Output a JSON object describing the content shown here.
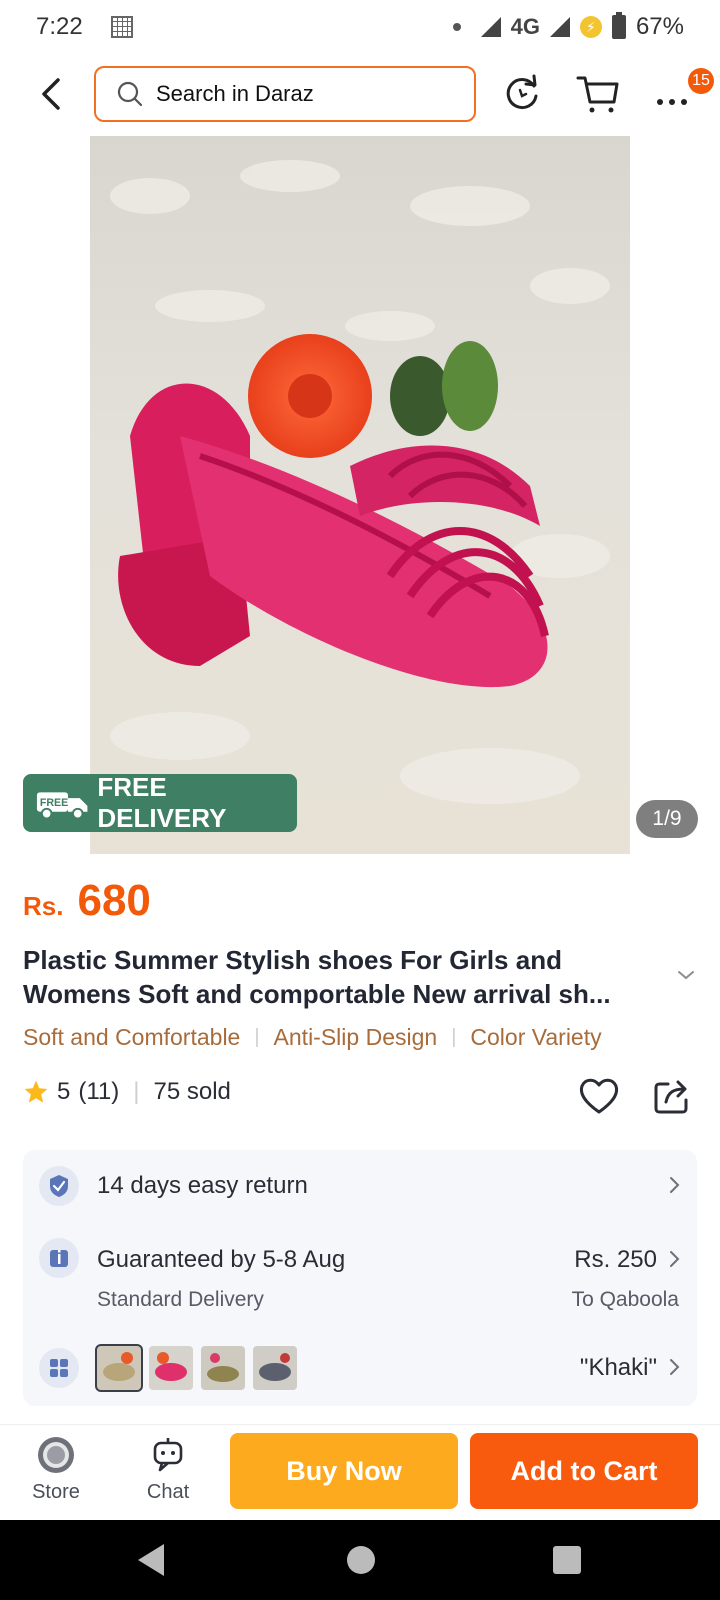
{
  "status_bar": {
    "time": "7:22",
    "network": "4G",
    "battery": "67%"
  },
  "search": {
    "placeholder": "Search in Daraz"
  },
  "header": {
    "badge_count": "15"
  },
  "gallery": {
    "free_delivery": "FREE DELIVERY",
    "free_tag": "FREE",
    "counter": "1/9"
  },
  "product": {
    "currency": "Rs.",
    "price": "680",
    "title_line1": "Plastic Summer Stylish shoes For Girls and",
    "title_line2": "Womens Soft and comportable New arrival sh...",
    "features": [
      "Soft and Comfortable",
      "Anti-Slip Design",
      "Color Variety"
    ],
    "rating": "5",
    "review_count": "(11)",
    "sold": "75 sold"
  },
  "info": {
    "return_text": "14 days easy return",
    "delivery_title": "Guaranteed by 5-8 Aug",
    "delivery_type": "Standard Delivery",
    "delivery_fee": "Rs. 250",
    "delivery_to": "To Qaboola",
    "variant_selected": "\"Khaki\""
  },
  "bottom_bar": {
    "store_label": "Store",
    "chat_label": "Chat",
    "buy_now_label": "Buy Now",
    "add_to_cart_label": "Add to Cart"
  },
  "colors": {
    "accent": "#f25a0a",
    "buy_now": "#fdaa1e",
    "add_to_cart": "#f85a0e",
    "free_delivery_bg": "#3f7f63",
    "feature_text": "#a86b3a"
  },
  "icons": [
    "back-icon",
    "search-icon",
    "refresh-icon",
    "cart-icon",
    "more-icon",
    "truck-icon",
    "chevron-down-icon",
    "star-icon",
    "heart-icon",
    "share-icon",
    "shield-icon",
    "info-icon",
    "grid-icon",
    "store-icon",
    "chat-icon"
  ]
}
